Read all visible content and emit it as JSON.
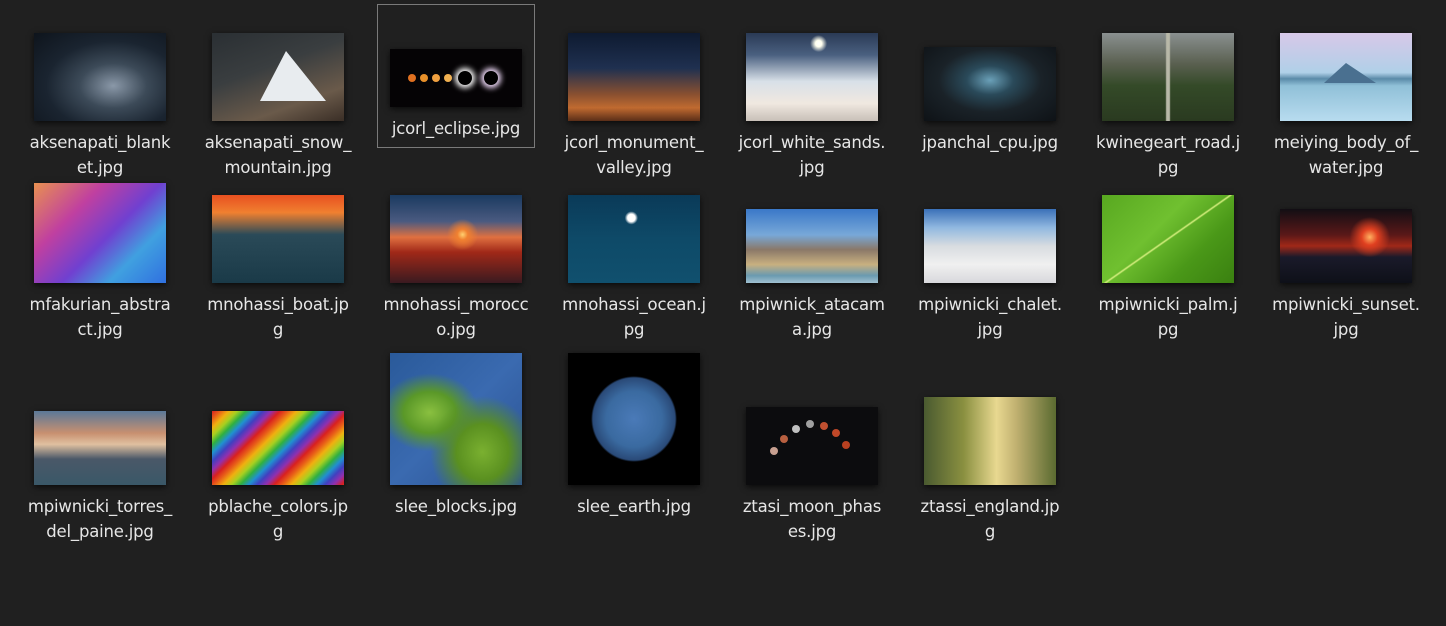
{
  "files": [
    {
      "name": "aksenapati_blank​et.jpg"
    },
    {
      "name": "aksenapati_snow​_mountain.jpg"
    },
    {
      "name": "jcorl_eclipse.jpg"
    },
    {
      "name": "jcorl_monument_​valley.jpg"
    },
    {
      "name": "jcorl_white_sands​.jpg"
    },
    {
      "name": "jpanchal_cpu.jpg"
    },
    {
      "name": "kwinegeart_road.j​pg"
    },
    {
      "name": "meiying_body_of​_water.jpg"
    },
    {
      "name": "mfakurian_abstra​ct.jpg"
    },
    {
      "name": "mnohassi_boat.j​pg"
    },
    {
      "name": "mnohassi_moroc​co.jpg"
    },
    {
      "name": "mnohassi_ocean.j​pg"
    },
    {
      "name": "mpiwnick_ataca​ma.jpg"
    },
    {
      "name": "mpiwnicki_chalet.​jpg"
    },
    {
      "name": "mpiwnicki_palm.j​pg"
    },
    {
      "name": "mpiwnicki_sunset​.jpg"
    },
    {
      "name": "mpiwnicki_torres​_del_paine.jpg"
    },
    {
      "name": "pblache_colors.jp​g"
    },
    {
      "name": "slee_blocks.jpg"
    },
    {
      "name": "slee_earth.jpg"
    },
    {
      "name": "ztasi_moon_phas​es.jpg"
    },
    {
      "name": "ztassi_england.jp​g"
    }
  ]
}
